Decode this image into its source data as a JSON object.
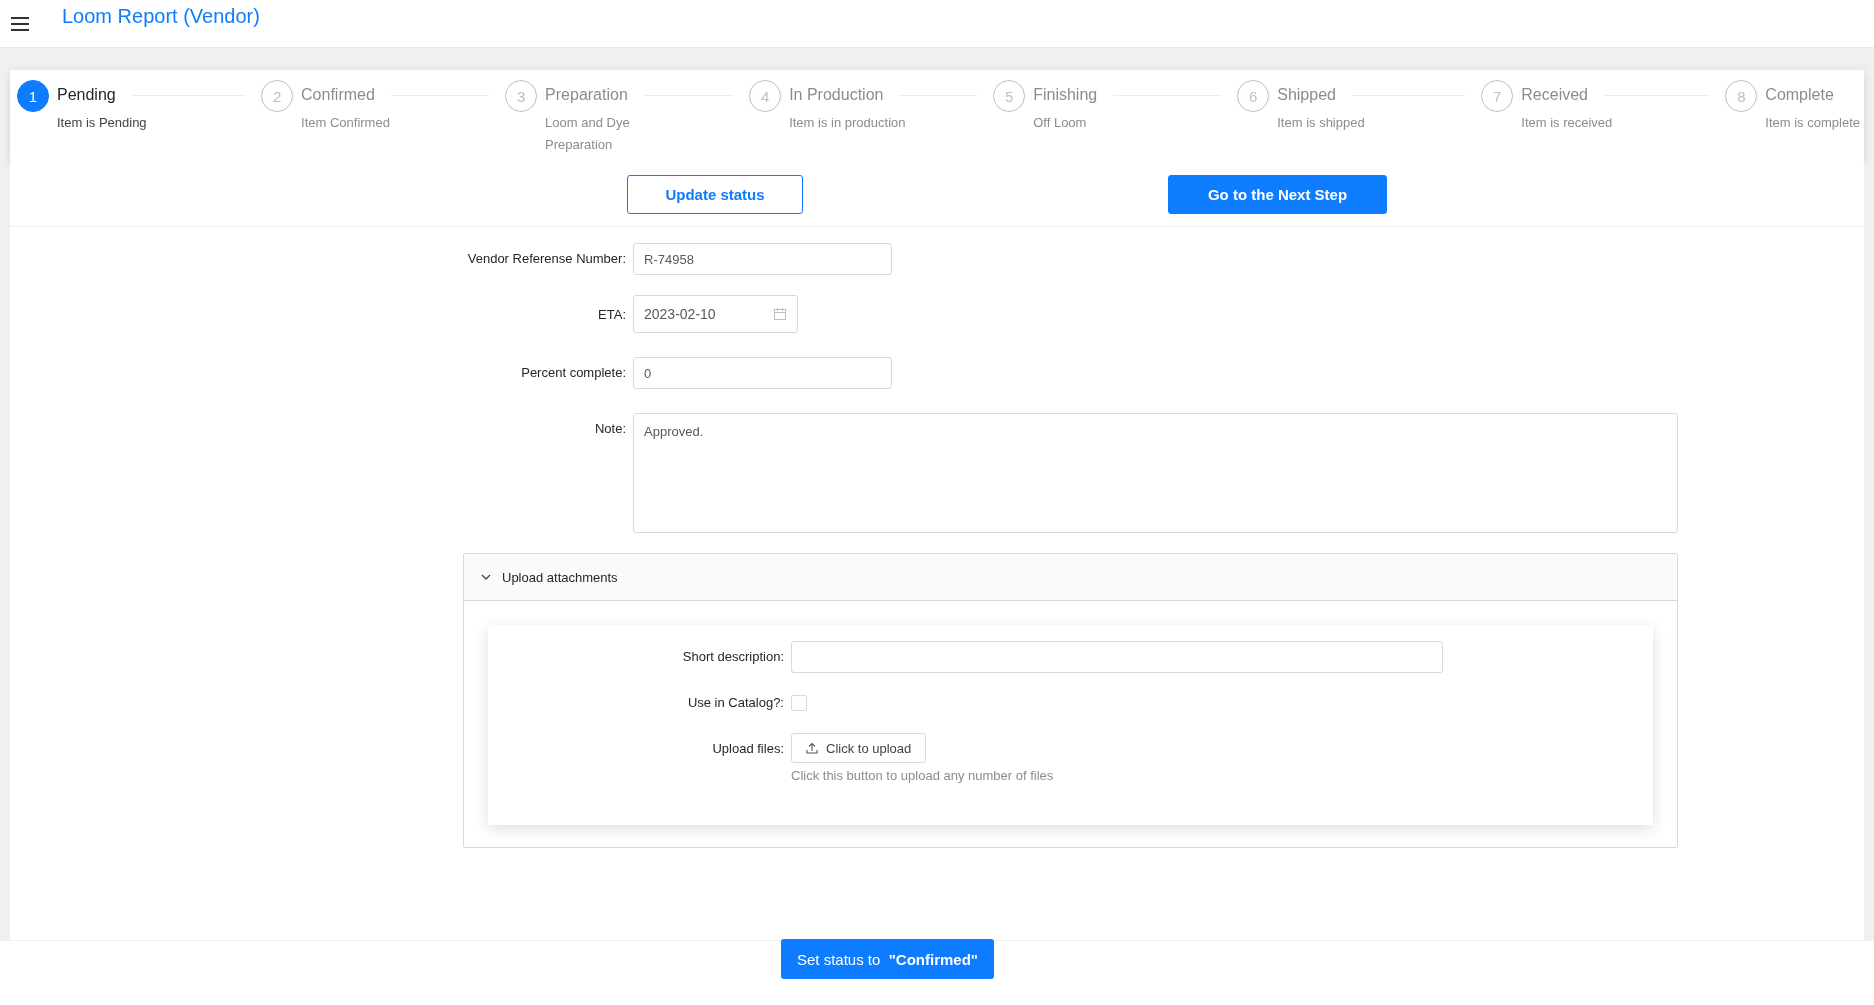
{
  "header": {
    "title": "Loom Report (Vendor)"
  },
  "steps": [
    {
      "number": "1",
      "title": "Pending",
      "description": "Item is Pending",
      "selected": true
    },
    {
      "number": "2",
      "title": "Confirmed",
      "description": "Item Confirmed",
      "selected": false
    },
    {
      "number": "3",
      "title": "Preparation",
      "description": "Loom and Dye Preparation",
      "selected": false
    },
    {
      "number": "4",
      "title": "In Production",
      "description": "Item is in production",
      "selected": false
    },
    {
      "number": "5",
      "title": "Finishing",
      "description": "Off Loom",
      "selected": false
    },
    {
      "number": "6",
      "title": "Shipped",
      "description": "Item is shipped",
      "selected": false
    },
    {
      "number": "7",
      "title": "Received",
      "description": "Item is received",
      "selected": false
    },
    {
      "number": "8",
      "title": "Complete",
      "description": "Item is complete",
      "selected": false
    }
  ],
  "actions": [
    {
      "kind": "outline",
      "label": "Update status"
    },
    {
      "kind": "primary",
      "label": "Go to the Next Step"
    }
  ],
  "form": {
    "fields": [
      {
        "kind": "text",
        "label": "Vendor Referense Number:",
        "value": "R-74958"
      },
      {
        "kind": "date",
        "label": "ETA:",
        "value": "2023-02-10"
      },
      {
        "kind": "text",
        "label": "Percent complete:",
        "value": "0"
      },
      {
        "kind": "textarea",
        "label": "Note:",
        "value": "Approved."
      }
    ]
  },
  "attachments": {
    "title": "Upload attachments",
    "expanded": true,
    "fields": [
      {
        "kind": "text",
        "label": "Short description:"
      },
      {
        "kind": "checkbox",
        "label": "Use in Catalog?:",
        "checked": false
      },
      {
        "kind": "upload",
        "label": "Upload files:",
        "button": "Click to upload",
        "hint": "Click this button to upload any number of files"
      }
    ]
  },
  "footer": {
    "button": "Set status to  **\"Confirmed\"**"
  }
}
